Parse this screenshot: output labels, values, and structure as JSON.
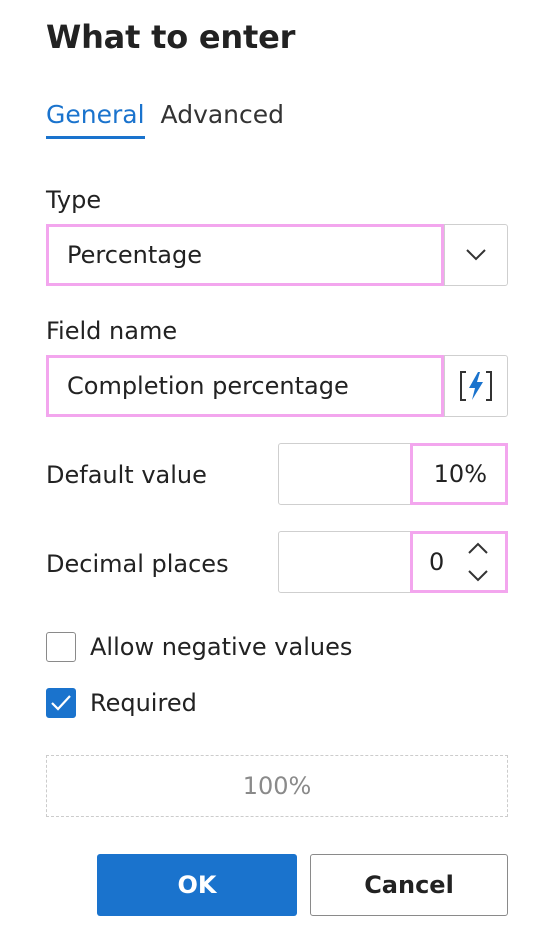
{
  "dialog": {
    "title": "What to enter"
  },
  "tabs": [
    {
      "label": "General",
      "active": true
    },
    {
      "label": "Advanced",
      "active": false
    }
  ],
  "type": {
    "label": "Type",
    "value": "Percentage",
    "icon": "chevron-down-icon"
  },
  "field_name": {
    "label": "Field name",
    "value": "Completion percentage",
    "icon": "lightning-bracket-icon"
  },
  "default_value": {
    "label": "Default value",
    "value": "10%"
  },
  "decimal_places": {
    "label": "Decimal places",
    "value": "0"
  },
  "options": {
    "allow_negative": {
      "label": "Allow negative values",
      "checked": false
    },
    "required": {
      "label": "Required",
      "checked": true
    }
  },
  "preview": {
    "value": "100%"
  },
  "buttons": {
    "ok": "OK",
    "cancel": "Cancel"
  },
  "colors": {
    "accent": "#1a73cd",
    "highlight": "#f3a6ee"
  }
}
